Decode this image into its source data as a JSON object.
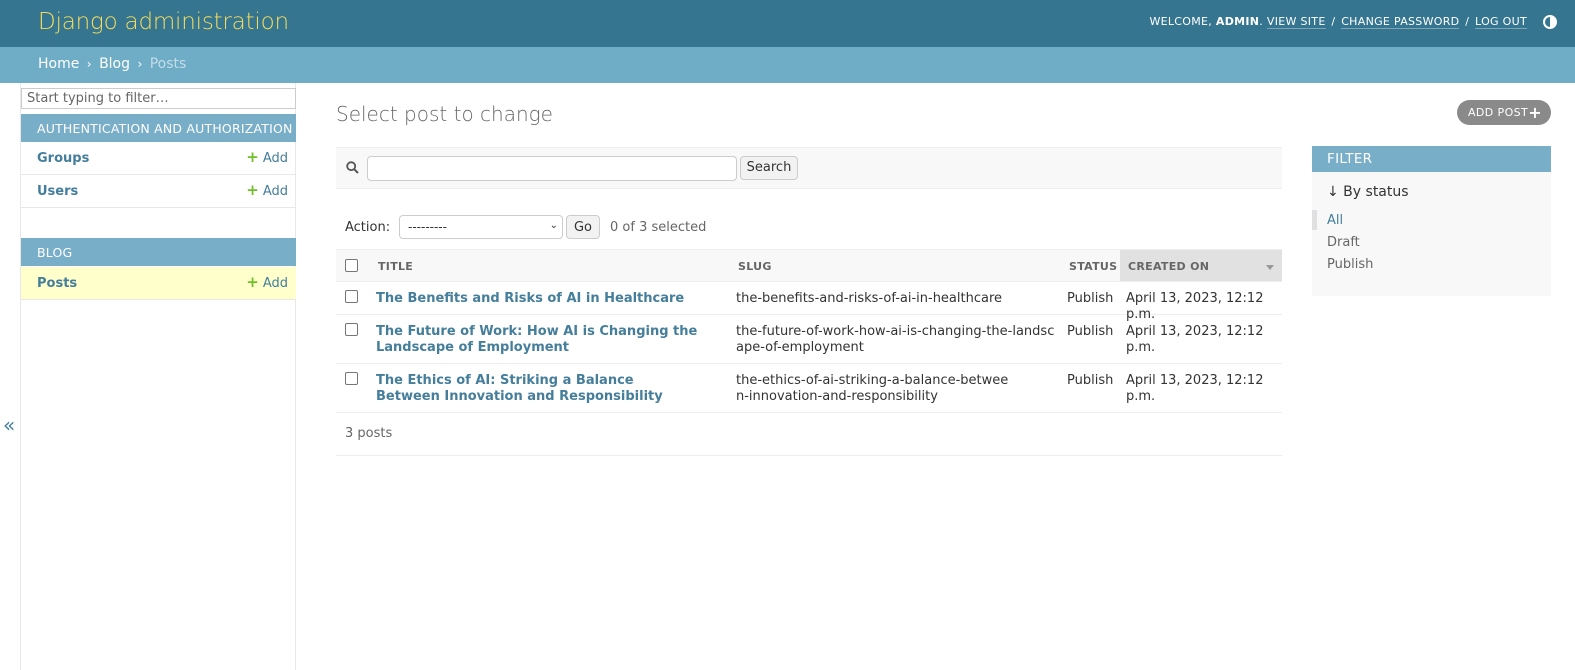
{
  "header": {
    "branding": "Django administration",
    "welcome": "Welcome,",
    "username": "admin",
    "view_site": "View site",
    "change_password": "Change password",
    "log_out": "Log out"
  },
  "breadcrumbs": {
    "home": "Home",
    "blog": "Blog",
    "current": "Posts"
  },
  "sidebar": {
    "filter_placeholder": "Start typing to filter…",
    "modules": [
      {
        "caption": "Authentication and Authorization",
        "models": [
          {
            "name": "Groups",
            "add": "Add"
          },
          {
            "name": "Users",
            "add": "Add"
          }
        ]
      },
      {
        "caption": "Blog",
        "models": [
          {
            "name": "Posts",
            "add": "Add"
          }
        ]
      }
    ],
    "toggle": "«"
  },
  "content": {
    "title": "Select post to change",
    "add_button": "Add post",
    "search_button": "Search",
    "action_label": "Action:",
    "action_select": "---------",
    "go_button": "Go",
    "action_counter": "0 of 3 selected",
    "columns": [
      "Title",
      "Slug",
      "Status",
      "Created on"
    ],
    "rows": [
      {
        "title": "The Benefits and Risks of AI in Healthcare",
        "slug": "the-benefits-and-risks-of-ai-in-healthcare",
        "status": "Publish",
        "created": "April 13, 2023, 12:12 p.m."
      },
      {
        "title": "The Future of Work: How AI is Changing the Landscape of Employment",
        "slug": "the-future-of-work-how-ai-is-changing-the-landscape-of-employment",
        "status": "Publish",
        "created": "April 13, 2023, 12:12 p.m."
      },
      {
        "title": "The Ethics of AI: Striking a Balance Between Innovation and Responsibility",
        "slug": "the-ethics-of-ai-striking-a-balance-between-innovation-and-responsibility",
        "status": "Publish",
        "created": "April 13, 2023, 12:12 p.m."
      }
    ],
    "paginator": "3 posts"
  },
  "filter": {
    "header": "Filter",
    "by": "↓ By status",
    "options": [
      "All",
      "Draft",
      "Publish"
    ]
  },
  "colors": {
    "header_bg": "#36758f",
    "branding": "#f5dd5d",
    "breadcrumbs_bg": "#6fadc7",
    "module_caption_bg": "#79aec8",
    "link": "#447e9b",
    "add_plus": "#70bf2b",
    "current_row": "#ffffcc"
  }
}
